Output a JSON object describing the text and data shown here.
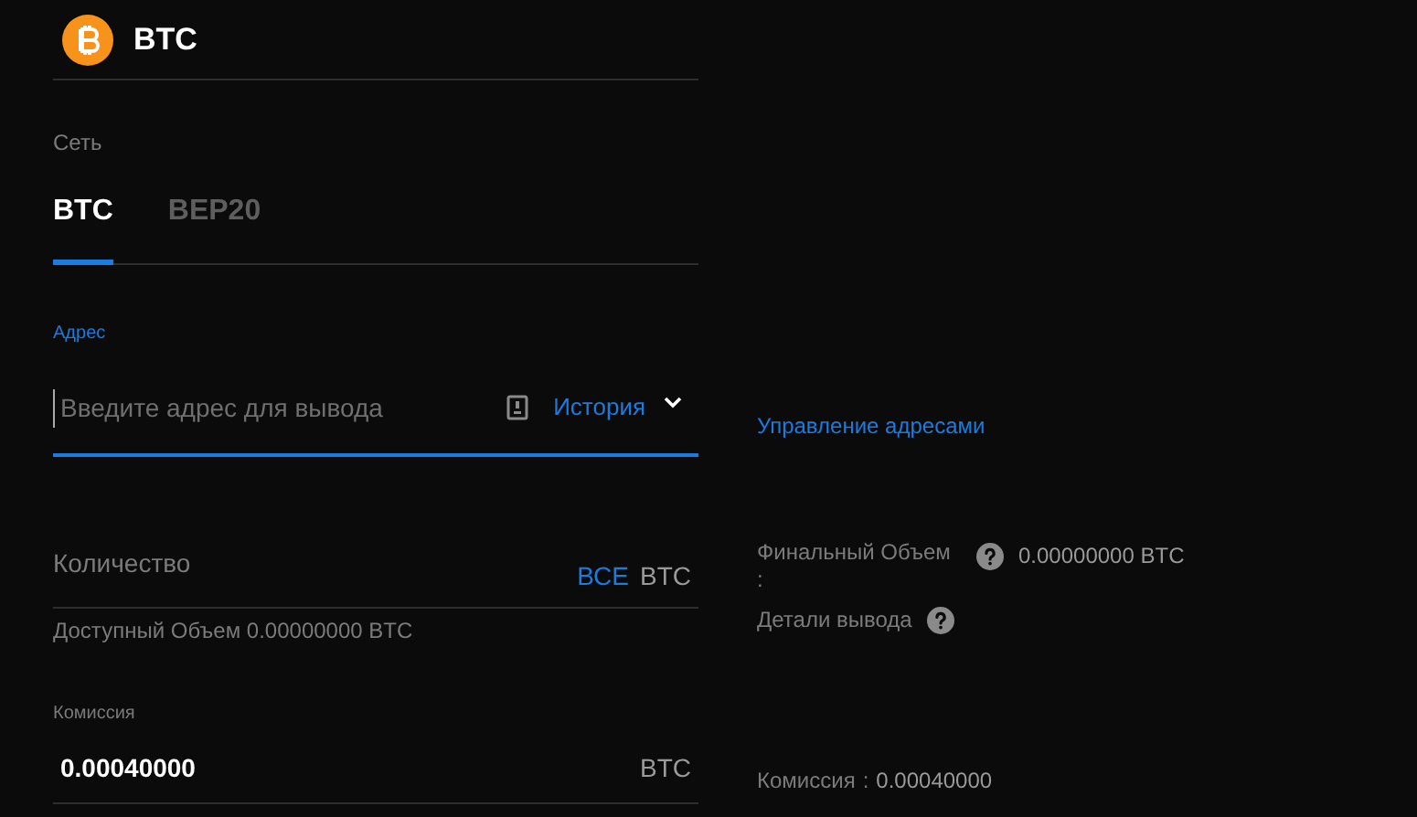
{
  "coin": {
    "symbol": "BTC"
  },
  "network": {
    "label": "Сеть",
    "tabs": [
      {
        "label": "BTC",
        "selected": true
      },
      {
        "label": "BEP20",
        "selected": false
      }
    ]
  },
  "address": {
    "label": "Адрес",
    "placeholder": "Введите адрес для вывода",
    "history": "История",
    "manage_link": "Управление адресами"
  },
  "amount": {
    "placeholder": "Количество",
    "all_button": "ВСЕ",
    "unit": "BTC",
    "available": "Доступный Объем 0.00000000 BTC"
  },
  "summary": {
    "final_label": "Финальный Объем",
    "final_sep": ":",
    "final_value": "0.00000000 BTC",
    "details_label": "Детали вывода"
  },
  "fee": {
    "label": "Комиссия",
    "value": "0.00040000",
    "unit": "BTC",
    "summary_label": "Комиссия",
    "summary_sep": ":",
    "summary_value": "0.00040000"
  }
}
